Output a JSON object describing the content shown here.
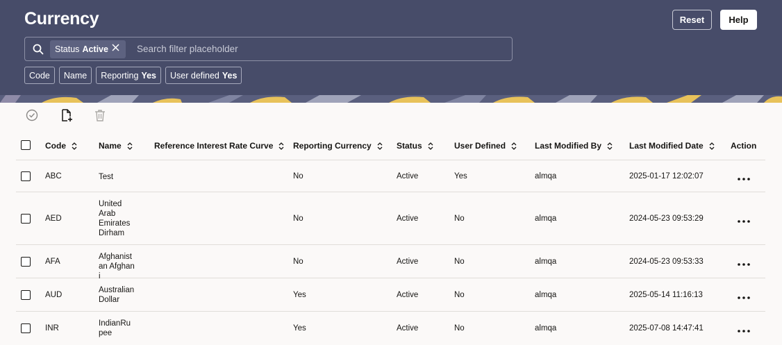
{
  "header": {
    "title": "Currency",
    "reset_label": "Reset",
    "help_label": "Help",
    "search": {
      "chip_key": "Status",
      "chip_value": "Active",
      "placeholder": "Search filter placeholder"
    },
    "filters": [
      {
        "label": "Code",
        "value": ""
      },
      {
        "label": "Name",
        "value": ""
      },
      {
        "label": "Reporting",
        "value": "Yes"
      },
      {
        "label": "User defined",
        "value": "Yes"
      }
    ]
  },
  "toolbar": {
    "icons": [
      "check-circle-icon",
      "new-document-icon",
      "delete-icon"
    ]
  },
  "table": {
    "columns": [
      "Code",
      "Name",
      "Reference Interest Rate Curve",
      "Reporting Currency",
      "Status",
      "User Defined",
      "Last Modified By",
      "Last Modified Date",
      "Action"
    ],
    "rows": [
      {
        "code": "ABC",
        "name": "Test",
        "curve": "",
        "reporting": "No",
        "status": "Active",
        "user_defined": "Yes",
        "modified_by": "almqa",
        "modified_date": "2025-01-17 12:02:07"
      },
      {
        "code": "AED",
        "name": "United Arab Emirates Dirham",
        "curve": "",
        "reporting": "No",
        "status": "Active",
        "user_defined": "No",
        "modified_by": "almqa",
        "modified_date": "2024-05-23 09:53:29"
      },
      {
        "code": "AFA",
        "name": "Afghanistan Afghani",
        "curve": "",
        "reporting": "No",
        "status": "Active",
        "user_defined": "No",
        "modified_by": "almqa",
        "modified_date": "2024-05-23 09:53:33"
      },
      {
        "code": "AUD",
        "name": "Australian Dollar",
        "curve": "",
        "reporting": "Yes",
        "status": "Active",
        "user_defined": "No",
        "modified_by": "almqa",
        "modified_date": "2025-05-14 11:16:13"
      },
      {
        "code": "INR",
        "name": "IndianRupee",
        "curve": "",
        "reporting": "Yes",
        "status": "Active",
        "user_defined": "No",
        "modified_by": "almqa",
        "modified_date": "2025-07-08 14:47:41"
      }
    ]
  },
  "colors": {
    "header_bg": "#474c69",
    "page_bg": "#fbf9f8",
    "accent_yellow": "#e8c25a"
  }
}
